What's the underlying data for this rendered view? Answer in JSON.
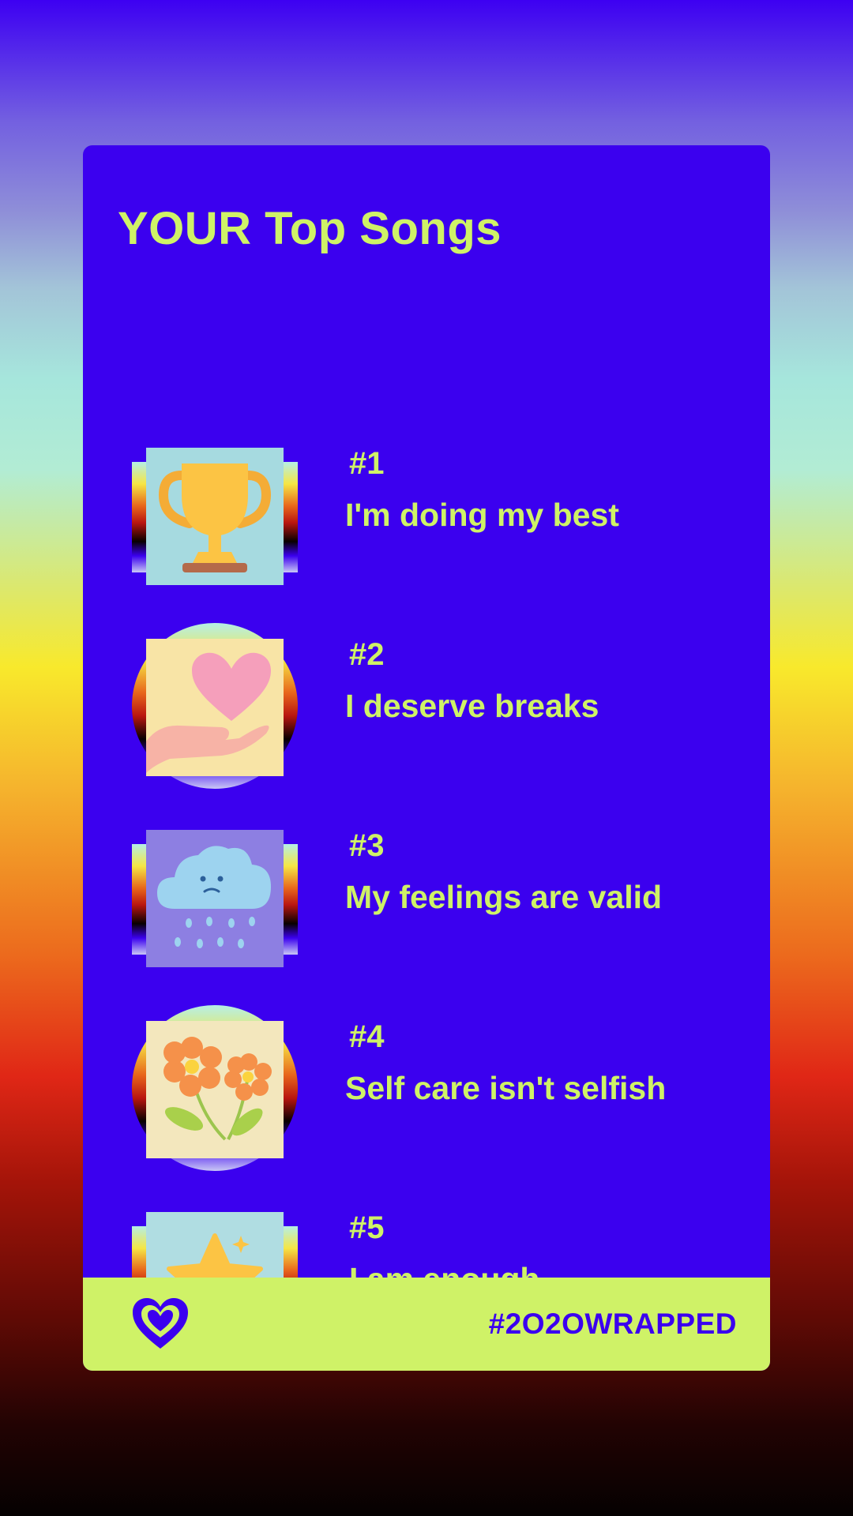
{
  "card": {
    "title": "YOUR Top Songs"
  },
  "songs": [
    {
      "rank": "#1",
      "name": "I'm doing my best",
      "icon": "trophy-icon",
      "frame": "square"
    },
    {
      "rank": "#2",
      "name": "I deserve breaks",
      "icon": "heart-in-hand-icon",
      "frame": "circle"
    },
    {
      "rank": "#3",
      "name": "My feelings are valid",
      "icon": "rain-cloud-icon",
      "frame": "square"
    },
    {
      "rank": "#4",
      "name": "Self care isn't selfish",
      "icon": "flowers-icon",
      "frame": "circle"
    },
    {
      "rank": "#5",
      "name": "I am enough",
      "icon": "star-icon",
      "frame": "square"
    }
  ],
  "footer": {
    "icon": "heart-outline-icon",
    "hashtag": "#2O2OWRAPPED"
  },
  "colors": {
    "card": "#3b00ef",
    "accent": "#cff267"
  }
}
